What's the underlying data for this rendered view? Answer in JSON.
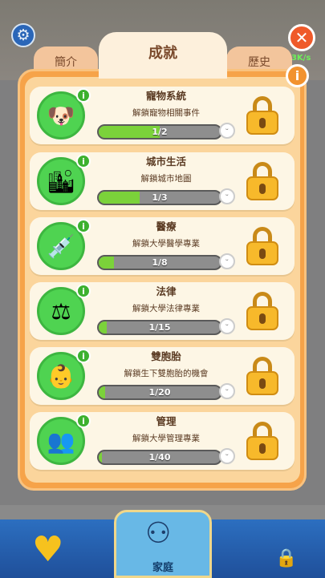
{
  "header": {
    "money_rate": "33K/s"
  },
  "tabs": {
    "left": "簡介",
    "active": "成就",
    "right": "歷史"
  },
  "icons": {
    "settings": "gear-icon",
    "close": "close-icon",
    "info": "info-icon",
    "lock": "lock-icon"
  },
  "achievements": [
    {
      "title": "寵物系統",
      "desc": "解鎖寵物相關事件",
      "progress": "1/2",
      "fraction": 0.5,
      "icon": "dog-icon"
    },
    {
      "title": "城市生活",
      "desc": "解鎖城市地圖",
      "progress": "1/3",
      "fraction": 0.333,
      "icon": "city-icon"
    },
    {
      "title": "醫療",
      "desc": "解鎖大學醫學專業",
      "progress": "1/8",
      "fraction": 0.125,
      "icon": "medical-icon"
    },
    {
      "title": "法律",
      "desc": "解鎖大學法律專業",
      "progress": "1/15",
      "fraction": 0.067,
      "icon": "law-scale-icon"
    },
    {
      "title": "雙胞胎",
      "desc": "解鎖生下雙胞胎的機會",
      "progress": "1/20",
      "fraction": 0.05,
      "icon": "twins-icon"
    },
    {
      "title": "管理",
      "desc": "解鎖大學管理專業",
      "progress": "1/40",
      "fraction": 0.025,
      "icon": "management-icon"
    }
  ],
  "bottom_nav": {
    "home_label": "家庭"
  },
  "colors": {
    "panel": "#f6a349",
    "progress_fill": "#7bd23a",
    "icon_bg": "#4fd351"
  }
}
